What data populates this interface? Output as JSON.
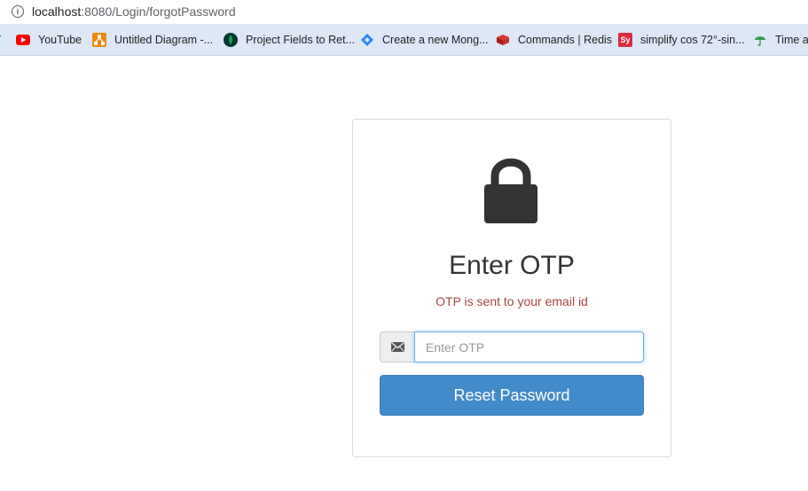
{
  "browser": {
    "url_host": "localhost",
    "url_path": ":8080/Login/forgotPassword",
    "info_icon": "info-icon"
  },
  "bookmarks": {
    "cut_prefix": "r",
    "items": [
      {
        "label": "YouTube",
        "icon": "youtube-icon"
      },
      {
        "label": "Untitled Diagram -...",
        "icon": "drawio-icon"
      },
      {
        "label": "Project Fields to Ret...",
        "icon": "mongodb-leaf-icon"
      },
      {
        "label": "Create a new Mong...",
        "icon": "jira-icon"
      },
      {
        "label": "Commands | Redis",
        "icon": "redis-icon"
      },
      {
        "label": "simplify cos 72°-sin...",
        "icon": "symbolab-icon",
        "icon_text": "Sy"
      },
      {
        "label": "Time ar",
        "icon": "umbrella-icon"
      }
    ]
  },
  "card": {
    "icon": "lock-icon",
    "title": "Enter OTP",
    "subtitle": "OTP is sent to your email id",
    "input": {
      "placeholder": "Enter OTP",
      "value": "",
      "icon": "envelope-icon"
    },
    "button_label": "Reset Password"
  },
  "colors": {
    "subtitle": "#a94442",
    "button": "#428bca",
    "bookmarks_bar": "#dee7f6"
  }
}
